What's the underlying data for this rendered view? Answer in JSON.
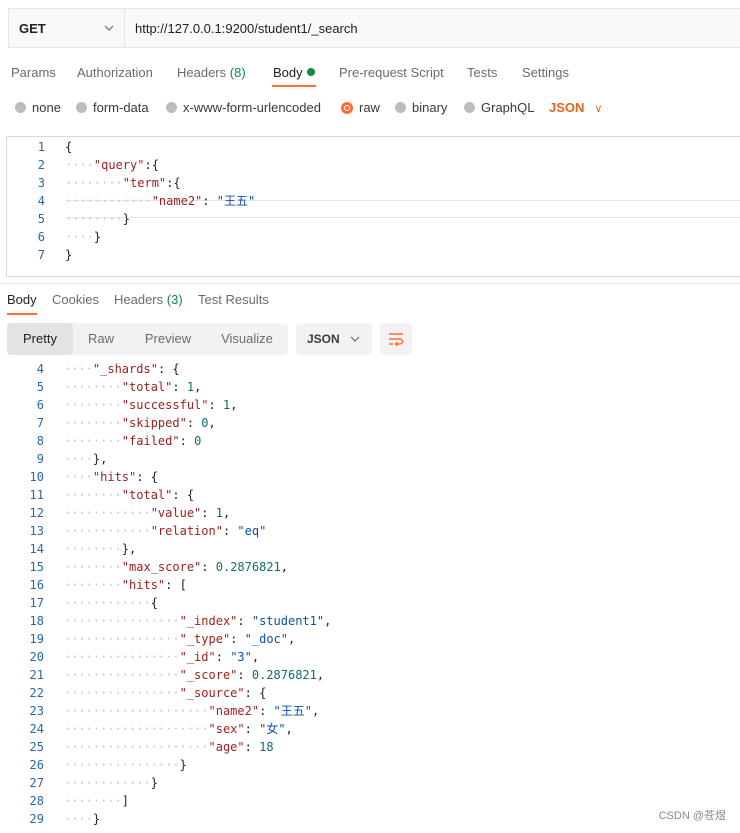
{
  "request": {
    "method": "GET",
    "url": "http://127.0.0.1:9200/student1/_search"
  },
  "request_tabs": [
    {
      "label": "Params",
      "count": ""
    },
    {
      "label": "Authorization",
      "count": ""
    },
    {
      "label": "Headers",
      "count": "(8)"
    },
    {
      "label": "Body",
      "count": ""
    },
    {
      "label": "Pre-request Script",
      "count": ""
    },
    {
      "label": "Tests",
      "count": ""
    },
    {
      "label": "Settings",
      "count": ""
    }
  ],
  "body_types": [
    "none",
    "form-data",
    "x-www-form-urlencoded",
    "raw",
    "binary",
    "GraphQL"
  ],
  "body_format": "JSON",
  "request_body": [
    {
      "n": "1",
      "indent": 0,
      "text": "{"
    },
    {
      "n": "2",
      "indent": 1,
      "text": "\"query\":{"
    },
    {
      "n": "3",
      "indent": 2,
      "text": "\"term\":{"
    },
    {
      "n": "4",
      "indent": 3,
      "text": "\"name2\": \"王五\""
    },
    {
      "n": "5",
      "indent": 2,
      "text": "}"
    },
    {
      "n": "6",
      "indent": 1,
      "text": "}"
    },
    {
      "n": "7",
      "indent": 0,
      "text": "}"
    }
  ],
  "response_tabs": [
    {
      "label": "Body",
      "count": ""
    },
    {
      "label": "Cookies",
      "count": ""
    },
    {
      "label": "Headers",
      "count": "(3)"
    },
    {
      "label": "Test Results",
      "count": ""
    }
  ],
  "view_modes": [
    "Pretty",
    "Raw",
    "Preview",
    "Visualize"
  ],
  "response_format": "JSON",
  "response_body": [
    {
      "n": "4",
      "indent": 1,
      "text": "\"_shards\": {"
    },
    {
      "n": "5",
      "indent": 2,
      "text": "\"total\": 1,"
    },
    {
      "n": "6",
      "indent": 2,
      "text": "\"successful\": 1,"
    },
    {
      "n": "7",
      "indent": 2,
      "text": "\"skipped\": 0,"
    },
    {
      "n": "8",
      "indent": 2,
      "text": "\"failed\": 0"
    },
    {
      "n": "9",
      "indent": 1,
      "text": "},"
    },
    {
      "n": "10",
      "indent": 1,
      "text": "\"hits\": {"
    },
    {
      "n": "11",
      "indent": 2,
      "text": "\"total\": {"
    },
    {
      "n": "12",
      "indent": 3,
      "text": "\"value\": 1,"
    },
    {
      "n": "13",
      "indent": 3,
      "text": "\"relation\": \"eq\""
    },
    {
      "n": "14",
      "indent": 2,
      "text": "},"
    },
    {
      "n": "15",
      "indent": 2,
      "text": "\"max_score\": 0.2876821,"
    },
    {
      "n": "16",
      "indent": 2,
      "text": "\"hits\": ["
    },
    {
      "n": "17",
      "indent": 3,
      "text": "{"
    },
    {
      "n": "18",
      "indent": 4,
      "text": "\"_index\": \"student1\","
    },
    {
      "n": "19",
      "indent": 4,
      "text": "\"_type\": \"_doc\","
    },
    {
      "n": "20",
      "indent": 4,
      "text": "\"_id\": \"3\","
    },
    {
      "n": "21",
      "indent": 4,
      "text": "\"_score\": 0.2876821,"
    },
    {
      "n": "22",
      "indent": 4,
      "text": "\"_source\": {"
    },
    {
      "n": "23",
      "indent": 5,
      "text": "\"name2\": \"王五\","
    },
    {
      "n": "24",
      "indent": 5,
      "text": "\"sex\": \"女\","
    },
    {
      "n": "25",
      "indent": 5,
      "text": "\"age\": 18"
    },
    {
      "n": "26",
      "indent": 4,
      "text": "}"
    },
    {
      "n": "27",
      "indent": 3,
      "text": "}"
    },
    {
      "n": "28",
      "indent": 2,
      "text": "]"
    },
    {
      "n": "29",
      "indent": 1,
      "text": "}"
    }
  ],
  "watermark": "CSDN @苍煜"
}
